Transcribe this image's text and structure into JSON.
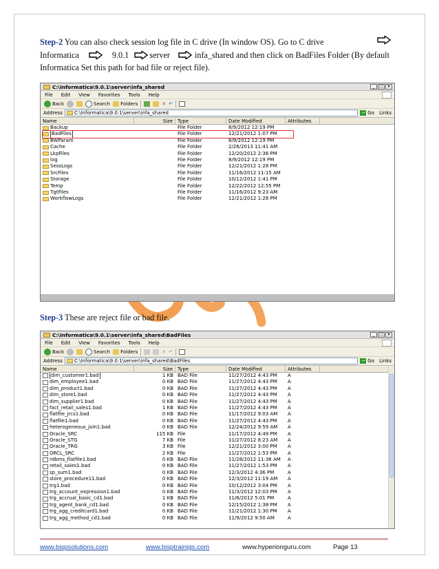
{
  "step2": {
    "label": "Step-2",
    "lines": [
      [
        "You can also check session log file in C drive (In window OS). Go to C drive"
      ],
      [
        "Informatica",
        "9.0.1",
        "server",
        "infa_shared and then click on BadFiles Folder (By default"
      ],
      [
        "Informatica Set this path for bad file or reject file)."
      ]
    ]
  },
  "step3": {
    "label": "Step-3",
    "text": "These are reject file or bad file."
  },
  "colors": {
    "step": "#1f3b8f",
    "link": "#1f4fb5",
    "rule": "#9e2a2a",
    "highlight": "#e0303b",
    "watermark": "#f29a4a"
  },
  "win1": {
    "title": "C:\\Informatica\\9.0.1\\server\\infa_shared",
    "menu": [
      "File",
      "Edit",
      "View",
      "Favorites",
      "Tools",
      "Help"
    ],
    "toolbar": {
      "back": "Back",
      "search": "Search",
      "folders": "Folders"
    },
    "address_label": "Address",
    "address": "C:\\Informatica\\9.0.1\\server\\infa_shared",
    "go": "Go",
    "links": "Links",
    "columns": [
      "Name",
      "Size",
      "Type",
      "Date Modified",
      "Attributes"
    ],
    "rows": [
      [
        "Backup",
        "",
        "File Folder",
        "8/9/2012 12:19 PM",
        ""
      ],
      [
        "BadFiles",
        "",
        "File Folder",
        "12/21/2012 1:07 PM",
        ""
      ],
      [
        "BWParam",
        "",
        "File Folder",
        "8/9/2012 12:19 PM",
        ""
      ],
      [
        "Cache",
        "",
        "File Folder",
        "2/26/2013 11:41 AM",
        ""
      ],
      [
        "LkpFiles",
        "",
        "File Folder",
        "12/20/2012 2:36 PM",
        ""
      ],
      [
        "log",
        "",
        "File Folder",
        "8/9/2012 12:19 PM",
        ""
      ],
      [
        "SessLogs",
        "",
        "File Folder",
        "12/21/2012 1:28 PM",
        ""
      ],
      [
        "SrcFiles",
        "",
        "File Folder",
        "11/16/2012 11:15 AM",
        ""
      ],
      [
        "Storage",
        "",
        "File Folder",
        "10/12/2012 1:41 PM",
        ""
      ],
      [
        "Temp",
        "",
        "File Folder",
        "12/22/2012 12:55 PM",
        ""
      ],
      [
        "TgtFiles",
        "",
        "File Folder",
        "11/16/2012 9:23 AM",
        ""
      ],
      [
        "WorkflowLogs",
        "",
        "File Folder",
        "12/21/2012 1:28 PM",
        ""
      ]
    ]
  },
  "win2": {
    "title": "C:\\Informatica\\9.0.1\\server\\infa_shared\\BadFiles",
    "menu": [
      "File",
      "Edit",
      "View",
      "Favorites",
      "Tools",
      "Help"
    ],
    "toolbar": {
      "back": "Back",
      "search": "Search",
      "folders": "Folders"
    },
    "address_label": "Address",
    "address": "C:\\Informatica\\9.0.1\\server\\infa_shared\\BadFiles",
    "go": "Go",
    "links": "Links",
    "columns": [
      "Name",
      "Size",
      "Type",
      "Date Modified",
      "Attributes"
    ],
    "rows": [
      [
        "dim_customer1.bad",
        "1 KB",
        "BAD File",
        "11/27/2012 4:43 PM",
        "A"
      ],
      [
        "dim_employee1.bad",
        "0 KB",
        "BAD File",
        "11/27/2012 4:43 PM",
        "A"
      ],
      [
        "dim_product1.bad",
        "0 KB",
        "BAD File",
        "11/27/2012 4:43 PM",
        "A"
      ],
      [
        "dim_store1.bad",
        "0 KB",
        "BAD File",
        "11/27/2012 4:43 PM",
        "A"
      ],
      [
        "dim_supplier1.bad",
        "0 KB",
        "BAD File",
        "11/27/2012 4:43 PM",
        "A"
      ],
      [
        "fact_retail_sales1.bad",
        "1 KB",
        "BAD File",
        "11/27/2012 4:43 PM",
        "A"
      ],
      [
        "flatfile_jrcs1.bad",
        "0 KB",
        "BAD File",
        "11/17/2012 9:03 AM",
        "A"
      ],
      [
        "flatfile1.bad",
        "0 KB",
        "BAD File",
        "11/27/2012 4:43 PM",
        "A"
      ],
      [
        "heterogeneous_join1.bad",
        "0 KB",
        "BAD File",
        "12/24/2012 9:59 AM",
        "A"
      ],
      [
        "Oracle_SRC",
        "115 KB",
        "File",
        "11/17/2012 4:49 PM",
        "A"
      ],
      [
        "Oracle_STG",
        "7 KB",
        "File",
        "11/27/2012 8:23 AM",
        "A"
      ],
      [
        "Oracle_TRG",
        "3 KB",
        "File",
        "12/21/2012 3:00 PM",
        "A"
      ],
      [
        "ORCL_SRC",
        "2 KB",
        "File",
        "11/27/2012 1:53 PM",
        "A"
      ],
      [
        "rdbms_flatfile1.bad",
        "0 KB",
        "BAD File",
        "11/28/2012 11:36 AM",
        "A"
      ],
      [
        "retail_sales1.bad",
        "0 KB",
        "BAD File",
        "11/27/2012 1:53 PM",
        "A"
      ],
      [
        "sp_sum1.bad",
        "0 KB",
        "BAD File",
        "12/3/2012 4:36 PM",
        "A"
      ],
      [
        "store_procedure11.bad",
        "0 KB",
        "BAD File",
        "12/3/2012 11:19 AM",
        "A"
      ],
      [
        "trg1.bad",
        "0 KB",
        "BAD File",
        "10/12/2012 3:04 PM",
        "A"
      ],
      [
        "trg_account_expression1.bad",
        "0 KB",
        "BAD File",
        "11/3/2012 12:03 PM",
        "A"
      ],
      [
        "trg_accrual_basic_cd1.bad",
        "1 KB",
        "BAD File",
        "11/6/2012 5:01 PM",
        "A"
      ],
      [
        "trg_agent_bank_cd1.bad",
        "0 KB",
        "BAD File",
        "12/15/2012 1:38 PM",
        "A"
      ],
      [
        "trg_agg_creditcard1.bad",
        "0 KB",
        "BAD File",
        "11/21/2012 1:30 PM",
        "A"
      ],
      [
        "trg_agg_method_cd1.bad",
        "0 KB",
        "BAD File",
        "11/9/2012 9:50 AM",
        "A"
      ]
    ]
  },
  "footer": {
    "link1": "www.bispsolutions.com",
    "link2": "www.bisptrainigs.com",
    "link3": "www.hyperionguru.com",
    "page": "Page 13"
  }
}
